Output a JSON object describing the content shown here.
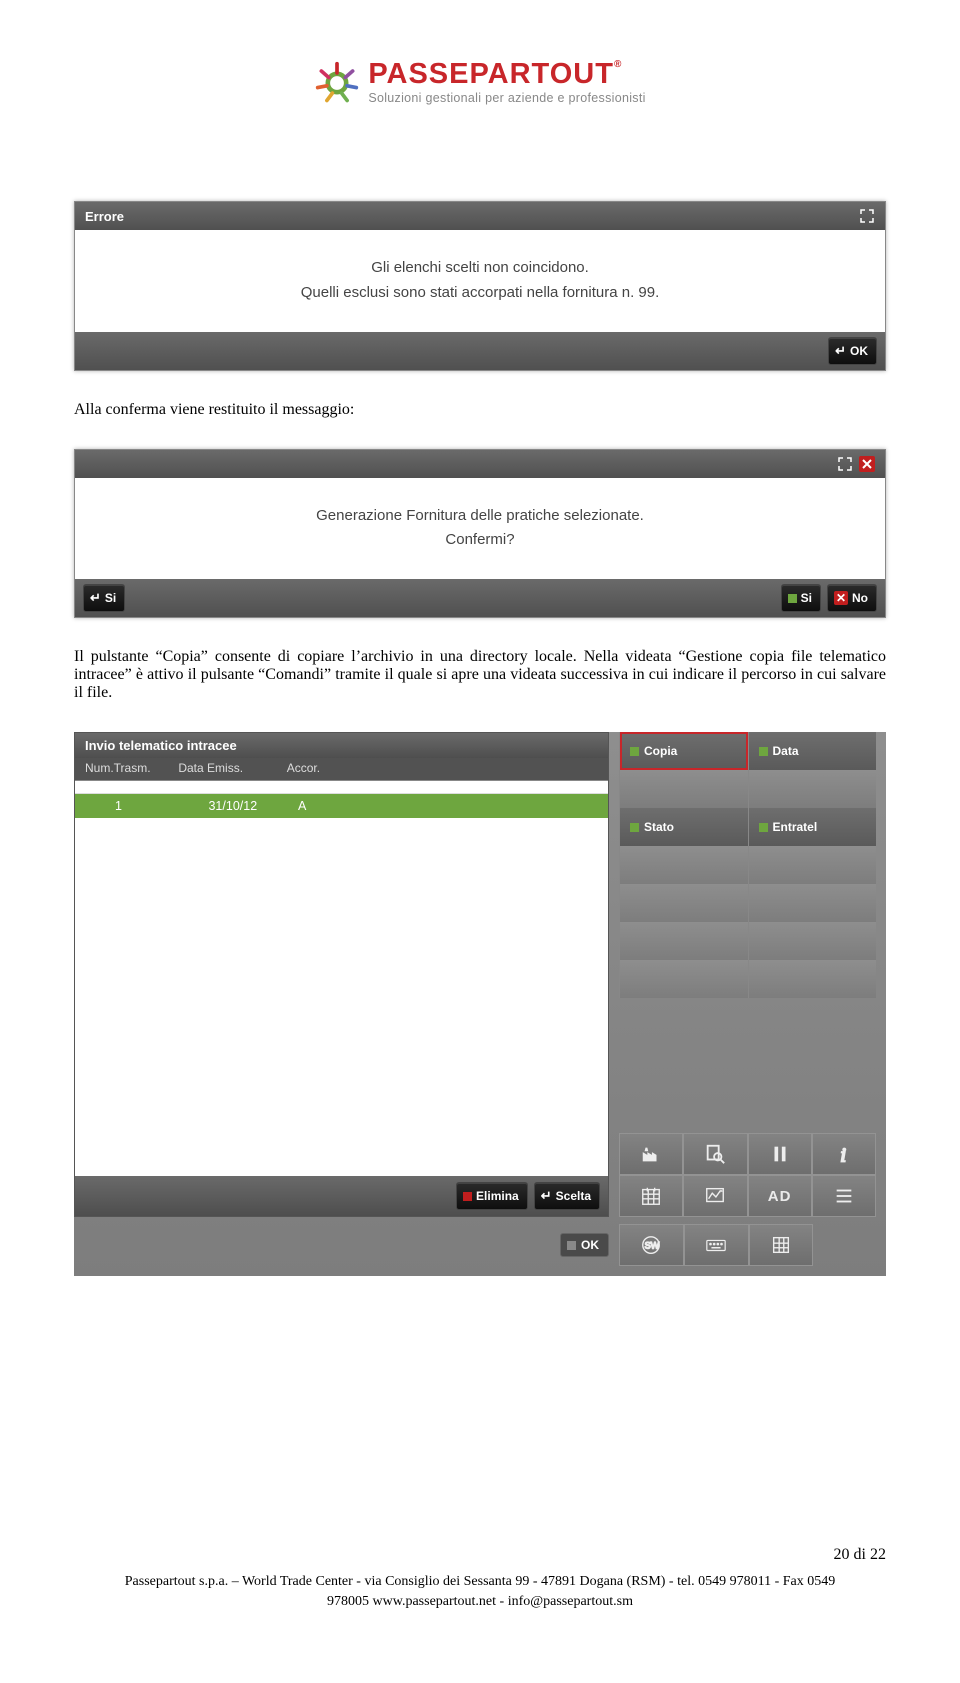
{
  "header": {
    "brand": "PASSEPARTOUT",
    "trademark": "®",
    "tagline": "Soluzioni gestionali per aziende e professionisti"
  },
  "error_dialog": {
    "title": "Errore",
    "line1": "Gli elenchi scelti non coincidono.",
    "line2": "Quelli esclusi sono stati accorpati nella fornitura n. 99.",
    "ok": "OK"
  },
  "para1": "Alla conferma viene restituito il messaggio:",
  "confirm_dialog": {
    "line1": "Generazione Fornitura delle pratiche selezionate.",
    "line2": "Confermi?",
    "si": "Si",
    "no": "No"
  },
  "para2": "Il pulstante “Copia” consente di copiare l’archivio in una directory locale. Nella videata “Gestione copia file telematico intracee” è attivo il pulsante “Comandi” tramite il quale si apre una videata successiva in cui indicare il percorso in cui salvare il file.",
  "app": {
    "title": "Invio telematico intracee",
    "cols": {
      "c1": "Num.Trasm.",
      "c2": "Data Emiss.",
      "c3": "Accor."
    },
    "row": {
      "num": "1",
      "date": "31/10/12",
      "acc": "A"
    },
    "btn_elimina": "Elimina",
    "btn_scelta": "Scelta",
    "right": {
      "copia": "Copia",
      "data": "Data",
      "stato": "Stato",
      "entratel": "Entratel",
      "ad": "AD"
    },
    "ok": "OK"
  },
  "page_num": "20 di 22",
  "footer": {
    "l1": "Passepartout s.p.a. – World Trade Center - via Consiglio dei Sessanta 99 - 47891 Dogana (RSM) - tel. 0549 978011 - Fax 0549",
    "l2": "978005 www.passepartout.net - info@passepartout.sm"
  }
}
